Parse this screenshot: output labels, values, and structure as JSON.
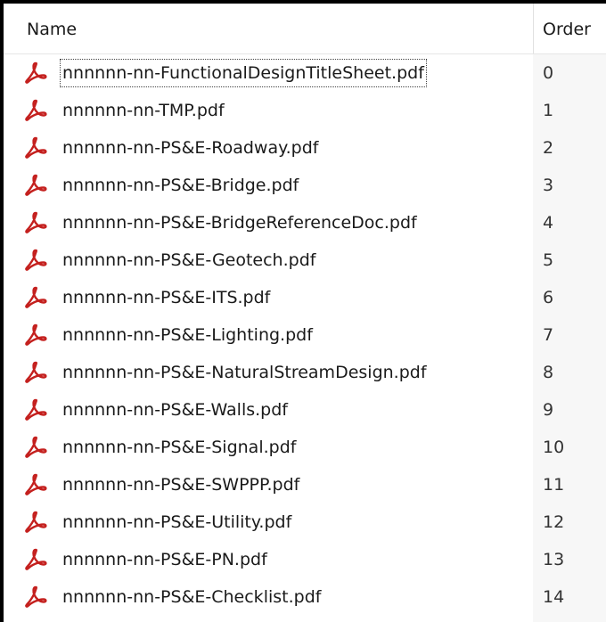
{
  "columns": {
    "name": "Name",
    "order": "Order"
  },
  "colors": {
    "pdf_icon": "#c4201e"
  },
  "files": [
    {
      "icon": "pdf-icon",
      "name": "nnnnnn-nn-FunctionalDesignTitleSheet.pdf",
      "order": "0",
      "focused": true
    },
    {
      "icon": "pdf-icon",
      "name": "nnnnnn-nn-TMP.pdf",
      "order": "1"
    },
    {
      "icon": "pdf-icon",
      "name": "nnnnnn-nn-PS&E-Roadway.pdf",
      "order": "2"
    },
    {
      "icon": "pdf-icon",
      "name": "nnnnnn-nn-PS&E-Bridge.pdf",
      "order": "3"
    },
    {
      "icon": "pdf-icon",
      "name": "nnnnnn-nn-PS&E-BridgeReferenceDoc.pdf",
      "order": "4"
    },
    {
      "icon": "pdf-icon",
      "name": "nnnnnn-nn-PS&E-Geotech.pdf",
      "order": "5"
    },
    {
      "icon": "pdf-icon",
      "name": "nnnnnn-nn-PS&E-ITS.pdf",
      "order": "6"
    },
    {
      "icon": "pdf-icon",
      "name": "nnnnnn-nn-PS&E-Lighting.pdf",
      "order": "7"
    },
    {
      "icon": "pdf-icon",
      "name": "nnnnnn-nn-PS&E-NaturalStreamDesign.pdf",
      "order": "8"
    },
    {
      "icon": "pdf-icon",
      "name": "nnnnnn-nn-PS&E-Walls.pdf",
      "order": "9"
    },
    {
      "icon": "pdf-icon",
      "name": "nnnnnn-nn-PS&E-Signal.pdf",
      "order": "10"
    },
    {
      "icon": "pdf-icon",
      "name": "nnnnnn-nn-PS&E-SWPPP.pdf",
      "order": "11"
    },
    {
      "icon": "pdf-icon",
      "name": "nnnnnn-nn-PS&E-Utility.pdf",
      "order": "12"
    },
    {
      "icon": "pdf-icon",
      "name": "nnnnnn-nn-PS&E-PN.pdf",
      "order": "13"
    },
    {
      "icon": "pdf-icon",
      "name": "nnnnnn-nn-PS&E-Checklist.pdf",
      "order": "14"
    }
  ]
}
